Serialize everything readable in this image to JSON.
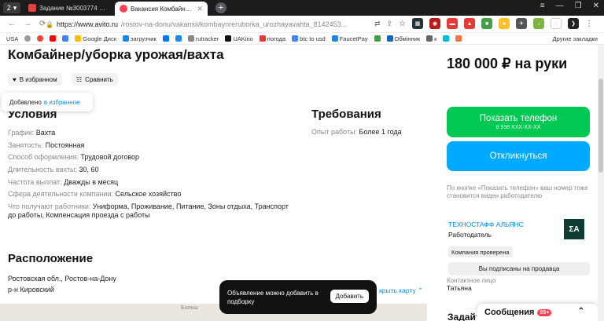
{
  "browser": {
    "tab_count": "2",
    "tabs": [
      {
        "label": "Задание №3003774 - про",
        "favicon": "$P",
        "color": "#e8403c"
      },
      {
        "label": "Вакансия Комбайнер/у",
        "favicon": "a",
        "color": "#ff4053"
      }
    ],
    "url_host": "https://www.avito.ru",
    "url_path": "/rostov-na-donu/vakansii/kombaynreruborka_urozhayavahta_8142453...",
    "bookmarks": [
      "USA",
      "",
      "",
      "",
      "",
      "Google Диск",
      "загрузчик",
      "",
      "",
      "rutracker",
      "UAKino",
      "погода",
      "btc to usd",
      "FaucetPay",
      "",
      "Обмінник",
      "к",
      "",
      ""
    ],
    "bookmarks_more": "Другие закладки"
  },
  "vacancy": {
    "title": "Комбайнер/уборка урожая/вахта",
    "favorite_label": "В избранном",
    "compare_label": "Сравнить",
    "toast_added": "Добавлено",
    "toast_added_link": "в избранное"
  },
  "conditions": {
    "heading": "Условия",
    "rows": [
      {
        "k": "График:",
        "v": "Вахта"
      },
      {
        "k": "Занятость:",
        "v": "Постоянная"
      },
      {
        "k": "Способ оформления:",
        "v": "Трудовой договор"
      },
      {
        "k": "Длительность вахты:",
        "v": "30, 60"
      },
      {
        "k": "Частота выплат:",
        "v": "Дважды в месяц"
      },
      {
        "k": "Сфера деятельности компании:",
        "v": "Сельское хозяйство"
      },
      {
        "k": "Что получают работники:",
        "v": "Униформа, Проживание, Питание, Зоны отдыха, Транспорт"
      }
    ],
    "extra_line": "до работы, Компенсация проезда с работы"
  },
  "requirements": {
    "heading": "Требования",
    "k": "Опыт работы:",
    "v": "Более 1 года"
  },
  "location": {
    "heading": "Расположение",
    "line1": "Ростовская обл., Ростов-на-Дону",
    "line2": "р-н Кировский",
    "show_map": "крыть карту ⌃",
    "map_road": "Больш"
  },
  "toast": {
    "text": "Объявление можно добавить в подборку",
    "button": "Добавить"
  },
  "sidebar": {
    "price": "180 000 ₽ на руки",
    "phone_label": "Показать телефон",
    "phone_masked": "8 938 XXX-XX-XX",
    "respond_label": "Откликнуться",
    "note": "По кнопке «Показать телефон» ваш номер тоже становится виден работодателю",
    "company_name": "ТЕХНОСТАФФ АЛЬЯНС",
    "company_role": "Работодатель",
    "logo_text": "ΣA",
    "verified": "Компания проверена",
    "subscribed": "Вы подписаны на продавца",
    "contact_label": "Контактное лицо",
    "contact_name": "Татьяна",
    "messages_label": "Сообщения",
    "messages_badge": "99+",
    "cut_heading": "Задайт"
  }
}
